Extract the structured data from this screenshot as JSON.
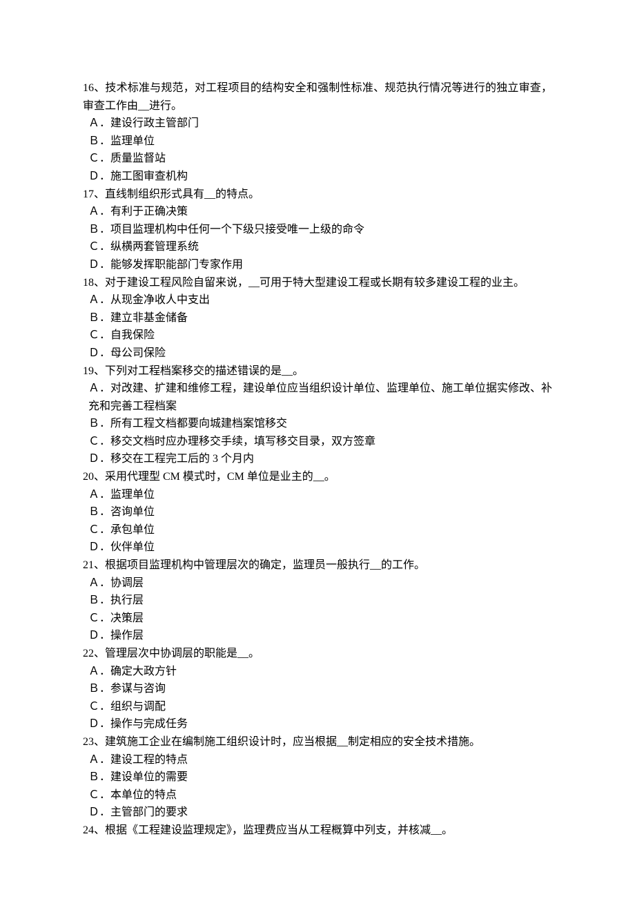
{
  "questions": [
    {
      "stem": "16、技术标准与规范，对工程项目的结构安全和强制性标准、规范执行情况等进行的独立审查，审查工作由__进行。",
      "options": [
        "Ａ．建设行政主管部门",
        "Ｂ．监理单位",
        "Ｃ．质量监督站",
        "Ｄ．施工图审查机构"
      ]
    },
    {
      "stem": "17、直线制组织形式具有__的特点。",
      "options": [
        "Ａ．有利于正确决策",
        "Ｂ．项目监理机构中任何一个下级只接受唯一上级的命令",
        "Ｃ．纵横两套管理系统",
        "Ｄ．能够发挥职能部门专家作用"
      ]
    },
    {
      "stem": "18、对于建设工程风险自留来说，__可用于特大型建设工程或长期有较多建设工程的业主。",
      "options": [
        "Ａ．从现金净收人中支出",
        "Ｂ．建立非基金储备",
        "Ｃ．自我保险",
        "Ｄ．母公司保险"
      ]
    },
    {
      "stem": "19、下列对工程档案移交的描述错误的是__。",
      "options": [
        "Ａ．对改建、扩建和维修工程，建设单位应当组织设计单位、监理单位、施工单位据实修改、补充和完善工程档案",
        "Ｂ．所有工程文档都要向城建档案馆移交",
        "Ｃ．移交文档时应办理移交手续，填写移交目录，双方签章",
        "Ｄ．移交在工程完工后的 3 个月内"
      ]
    },
    {
      "stem": "20、采用代理型 CM 模式时，CM 单位是业主的__。",
      "options": [
        "Ａ．监理单位",
        "Ｂ．咨询单位",
        "Ｃ．承包单位",
        "Ｄ．伙伴单位"
      ]
    },
    {
      "stem": "21、根据项目监理机构中管理层次的确定，监理员一般执行__的工作。",
      "options": [
        "Ａ．协调层",
        "Ｂ．执行层",
        "Ｃ．决策层",
        "Ｄ．操作层"
      ]
    },
    {
      "stem": "22、管理层次中协调层的职能是__。",
      "options": [
        "Ａ．确定大政方针",
        "Ｂ．参谋与咨询",
        "Ｃ．组织与调配",
        "Ｄ．操作与完成任务"
      ]
    },
    {
      "stem": "23、建筑施工企业在编制施工组织设计时，应当根据__制定相应的安全技术措施。",
      "options": [
        "Ａ．建设工程的特点",
        "Ｂ．建设单位的需要",
        "Ｃ．本单位的特点",
        "Ｄ．主管部门的要求"
      ]
    },
    {
      "stem": "24、根据《工程建设监理规定》，监理费应当从工程概算中列支，并核减__。",
      "options": []
    }
  ]
}
